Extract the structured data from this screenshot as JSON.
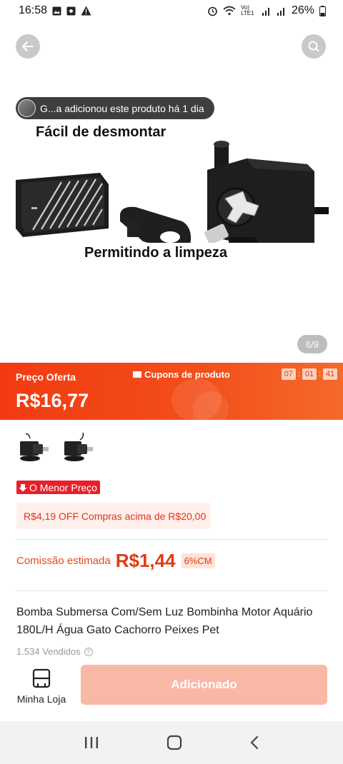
{
  "status_bar": {
    "time": "16:58",
    "network": "Vo) LTE1",
    "battery": "26%"
  },
  "hero": {
    "toast_text": "G...a adicionou este produto há 1 dia",
    "caption_top": "Fácil de desmontar",
    "caption_bottom": "Permitindo a limpeza",
    "pager": "6/9"
  },
  "price_banner": {
    "offer_label": "Preço Oferta",
    "price": "R$16,77",
    "coupon_label": "Cupons de produto",
    "timer": [
      "07",
      "01",
      "41"
    ],
    "colors": {
      "start": "#f23a12",
      "end": "#f46a2b"
    }
  },
  "variants": [
    {
      "name": "bomba-sem-luz"
    },
    {
      "name": "bomba-com-luz"
    }
  ],
  "badges": {
    "lowest_price": "O Menor Preço"
  },
  "discount": {
    "text": "R$4,19 OFF Compras acima de R$20,00"
  },
  "commission": {
    "label": "Comissão estimada",
    "value": "R$1,44",
    "rate": "6%CM"
  },
  "product": {
    "title": "Bomba Submersa Com/Sem Luz Bombinha Motor Aquário 180L/H Água Gato Cachorro Peixes Pet",
    "sold": "1.534 Vendidos"
  },
  "action_bar": {
    "store_label": "Minha Loja",
    "add_button": "Adicionado",
    "accent": "#f9b8a6"
  },
  "nav_icons": [
    "recents-icon",
    "home-icon",
    "back-icon"
  ]
}
